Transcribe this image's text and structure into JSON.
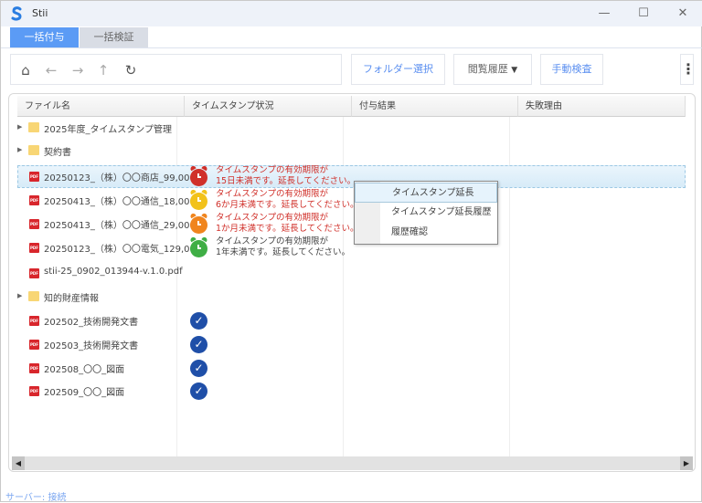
{
  "window": {
    "title": "Stii",
    "minimize": "—",
    "maximize": "☐",
    "close": "✕"
  },
  "tabs": [
    {
      "label": "一括付与",
      "active": true
    },
    {
      "label": "一括検証",
      "active": false
    }
  ],
  "toolbar": {
    "folder_select": "フォルダー選択",
    "history": "閲覧履歴",
    "history_caret": "▼",
    "manual_check": "手動検査",
    "more": "⋮",
    "nav": {
      "home": "⌂",
      "back": "←",
      "forward": "→",
      "up": "↑",
      "refresh": "↻"
    }
  },
  "table": {
    "columns": [
      "ファイル名",
      "タイムスタンプ状況",
      "付与結果",
      "失敗理由"
    ],
    "rows": [
      {
        "type": "folder",
        "name": "2025年度_タイムスタンプ管理"
      },
      {
        "type": "folder",
        "name": "契約書"
      },
      {
        "type": "pdf",
        "name": "20250123_（株）〇〇商店_99,000_",
        "status": "alarm",
        "color": "#d0302a",
        "msg1": "タイムスタンプの有効期限が",
        "msg2": "15日未満です。延長してください。",
        "msg_color": "#d0302a",
        "selected": true
      },
      {
        "type": "pdf",
        "name": "20250413_（株）〇〇通信_18,000_",
        "status": "alarm",
        "color": "#f2c21b",
        "msg1": "タイムスタンプの有効期限が",
        "msg2": "6か月未満です。延長してください。",
        "msg_color": "#d0302a"
      },
      {
        "type": "pdf",
        "name": "20250413_（株）〇〇通信_29,000_",
        "status": "alarm",
        "color": "#f0851e",
        "msg1": "タイムスタンプの有効期限が",
        "msg2": "1か月未満です。延長してください。",
        "msg_color": "#d0302a"
      },
      {
        "type": "pdf",
        "name": "20250123_（株）〇〇電気_129,000_",
        "status": "alarm",
        "color": "#3fae45",
        "msg1": "タイムスタンプの有効期限が",
        "msg2": "1年未満です。延長してください。",
        "msg_color": "#444444"
      },
      {
        "type": "pdf",
        "name": "stii-25_0902_013944-v.1.0.pdf"
      },
      {
        "type": "folder",
        "name": "知的財産情報"
      },
      {
        "type": "pdf",
        "name": "202502_技術開発文書",
        "status": "check"
      },
      {
        "type": "pdf",
        "name": "202503_技術開発文書",
        "status": "check"
      },
      {
        "type": "pdf",
        "name": "202508_〇〇_図面",
        "status": "check"
      },
      {
        "type": "pdf",
        "name": "202509_〇〇_図面",
        "status": "check"
      }
    ]
  },
  "context_menu": {
    "items": [
      "タイムスタンプ延長",
      "タイムスタンプ延長履歴",
      "履歴確認"
    ],
    "highlighted": 0
  },
  "pdf_icon_text": "PDF",
  "scroll": {
    "left": "◀",
    "right": "▶"
  },
  "status": {
    "text": "サーバー: 接続"
  },
  "colors": {
    "accent": "#5b9bf5",
    "check": "#1f4fa8"
  }
}
